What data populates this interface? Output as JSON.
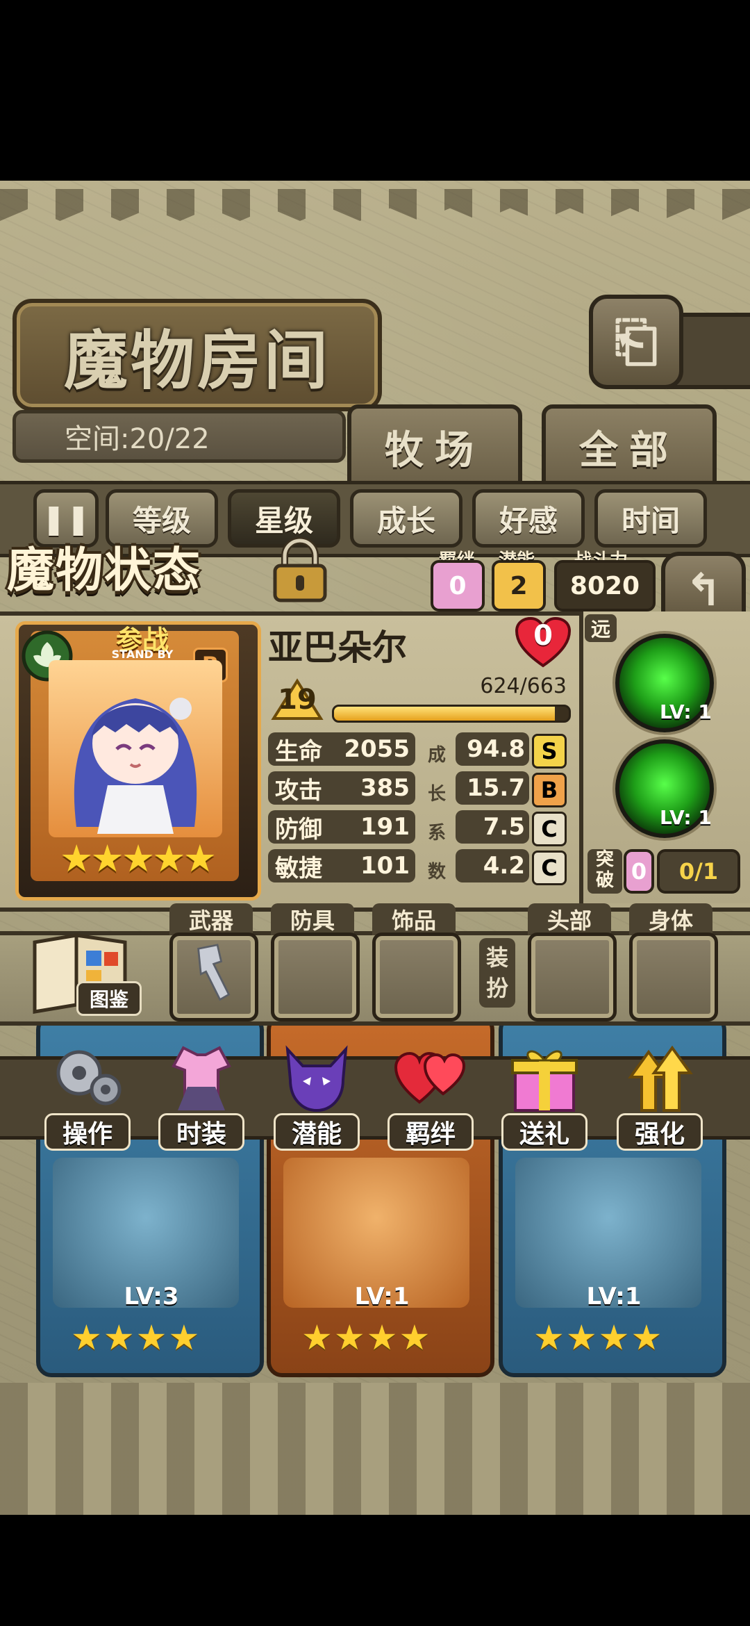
{
  "header": {
    "title": "魔物房间",
    "back_icon": "return-icon"
  },
  "space": {
    "label": "空间:20/22"
  },
  "tabs": [
    {
      "label": "牧场"
    },
    {
      "label": "全部"
    }
  ],
  "filters": [
    {
      "label": "等级",
      "selected": false
    },
    {
      "label": "星级",
      "selected": true
    },
    {
      "label": "成长",
      "selected": false
    },
    {
      "label": "好感",
      "selected": false
    },
    {
      "label": "时间",
      "selected": false
    }
  ],
  "status": {
    "title": "魔物状态",
    "chips": {
      "bond": {
        "label": "羁绊",
        "value": "0",
        "color": "#e8a0d0"
      },
      "potential": {
        "label": "潜能",
        "value": "2",
        "color": "#f2c14a"
      },
      "power": {
        "label": "战斗力",
        "value": "8020"
      }
    }
  },
  "monster": {
    "name": "亚巴朵尔",
    "affection": "0",
    "card_badge": "参战",
    "card_badge_sub": "STAND BY",
    "rank": "B",
    "stars": "★★★★★",
    "level": "19",
    "exp_text": "624/663",
    "exp_fraction": 0.94,
    "stats": [
      {
        "label": "生命",
        "value": "2055",
        "growth": "94.8",
        "grade": "S",
        "grade_color": "#f4d34a"
      },
      {
        "label": "攻击",
        "value": "385",
        "growth": "15.7",
        "grade": "B",
        "grade_color": "#f0a24a"
      },
      {
        "label": "防御",
        "value": "191",
        "growth": "7.5",
        "grade": "C",
        "grade_color": "#e8e0c8"
      },
      {
        "label": "敏捷",
        "value": "101",
        "growth": "4.2",
        "grade": "C",
        "grade_color": "#e8e0c8"
      }
    ],
    "growth_chars": [
      "成",
      "长",
      "系",
      "数"
    ]
  },
  "skills": {
    "range_label": "远",
    "items": [
      {
        "level": "LV: 1"
      },
      {
        "level": "LV: 1"
      }
    ],
    "breakthrough_label": "突破",
    "breakthrough_value": "0",
    "breakthrough_progress": "0/1"
  },
  "equipment": {
    "book_label": "图鉴",
    "slots": [
      {
        "label": "武器"
      },
      {
        "label": "防具"
      },
      {
        "label": "饰品"
      },
      {
        "label": "头部"
      },
      {
        "label": "身体"
      }
    ],
    "dress_label": [
      "装",
      "扮"
    ]
  },
  "actions": [
    {
      "label": "操作",
      "icon": "gears-icon"
    },
    {
      "label": "时装",
      "icon": "dress-icon"
    },
    {
      "label": "潜能",
      "icon": "demon-icon"
    },
    {
      "label": "羁绊",
      "icon": "hearts-icon"
    },
    {
      "label": "送礼",
      "icon": "gift-icon"
    },
    {
      "label": "强化",
      "icon": "upgrade-arrows-icon"
    }
  ],
  "monster_cards": [
    {
      "level": "LV:3",
      "stars": "★★★★"
    },
    {
      "level": "LV:1",
      "stars": "★★★★"
    },
    {
      "level": "LV:1",
      "stars": "★★★★"
    }
  ]
}
